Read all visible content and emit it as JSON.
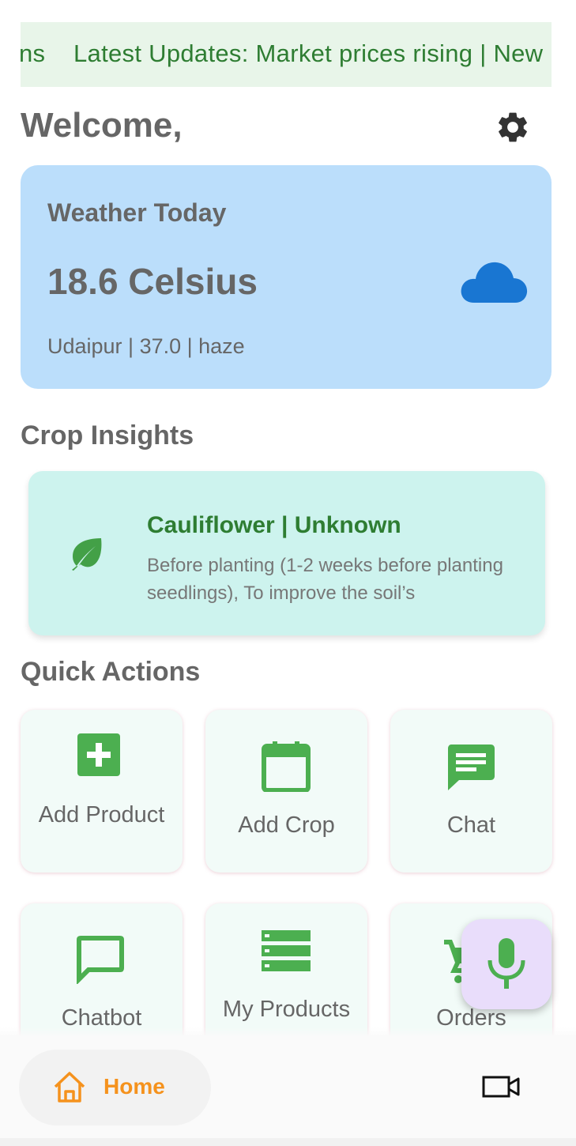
{
  "ticker": {
    "text": "ns    Latest Updates: Market prices rising | New"
  },
  "header": {
    "welcome": "Welcome,"
  },
  "weather": {
    "title": "Weather Today",
    "temperature": "18.6 Celsius",
    "meta": "Udaipur | 37.0 | haze",
    "icon": "cloud-icon"
  },
  "sections": {
    "crop_insights": "Crop Insights",
    "quick_actions": "Quick Actions"
  },
  "insight": {
    "title": "Cauliflower | Unknown",
    "description": "Before planting (1-2 weeks before planting seedlings), To improve the soil’s"
  },
  "actions": [
    {
      "label": "Add Product",
      "icon": "add-box-icon"
    },
    {
      "label": "Add Crop",
      "icon": "calendar-icon"
    },
    {
      "label": "Chat",
      "icon": "chat-bubble-icon"
    },
    {
      "label": "Chatbot",
      "icon": "chat-outline-icon"
    },
    {
      "label": "My Products",
      "icon": "list-icon"
    },
    {
      "label": "Orders",
      "icon": "cart-icon"
    }
  ],
  "nav": {
    "home": "Home"
  },
  "colors": {
    "accent_green": "#2e7d32",
    "icon_green": "#4caf50",
    "weather_bg": "#bbdefb",
    "insight_bg": "#cdf3ee",
    "nav_active": "#f5921d",
    "fab_bg": "#e9ddfb"
  }
}
